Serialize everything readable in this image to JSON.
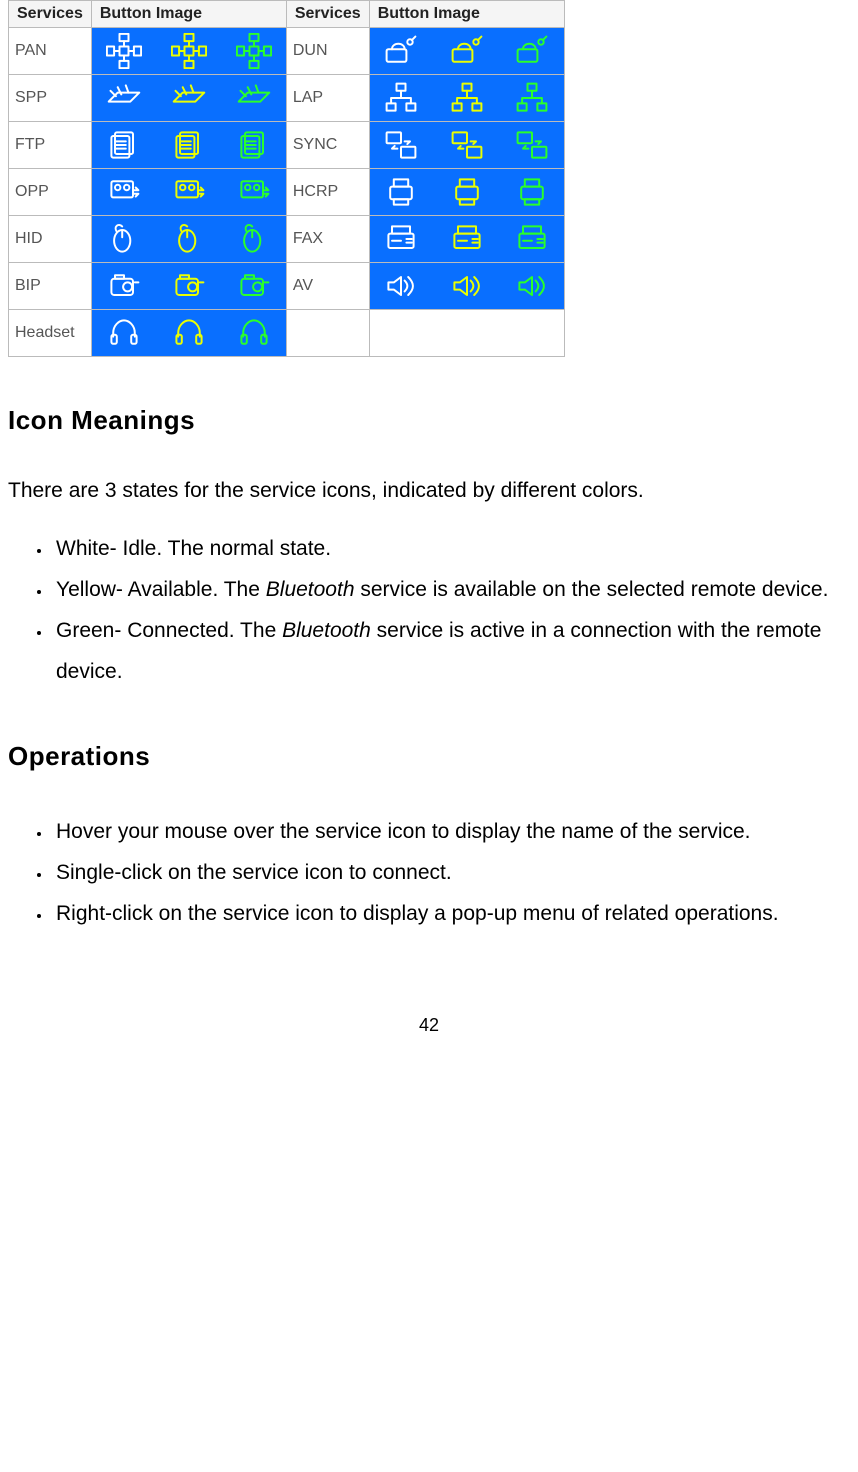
{
  "table": {
    "header_services": "Services",
    "header_image": "Button Image",
    "rows_left": [
      "PAN",
      "SPP",
      "FTP",
      "OPP",
      "HID",
      "BIP",
      "Headset"
    ],
    "rows_right": [
      "DUN",
      "LAP",
      "SYNC",
      "HCRP",
      "FAX",
      "AV",
      ""
    ]
  },
  "section1": {
    "title": "Icon Meanings",
    "intro": "There are 3 states for the service icons, indicated by different colors.",
    "items": {
      "white_label": "White- Idle. The normal state.",
      "yellow_prefix": "Yellow- Available. The ",
      "yellow_suffix": " service is available on the selected remote device.",
      "green_prefix": "Green- Connected. The ",
      "green_suffix": " service is active in a connection with the remote device.",
      "bluetooth": "Bluetooth"
    }
  },
  "section2": {
    "title": "Operations",
    "items": [
      "Hover your mouse over the service icon to display the name of the service.",
      "Single-click on the service icon to connect.",
      "Right-click on the service icon to display a pop-up menu of related operations."
    ]
  },
  "page_number": "42"
}
